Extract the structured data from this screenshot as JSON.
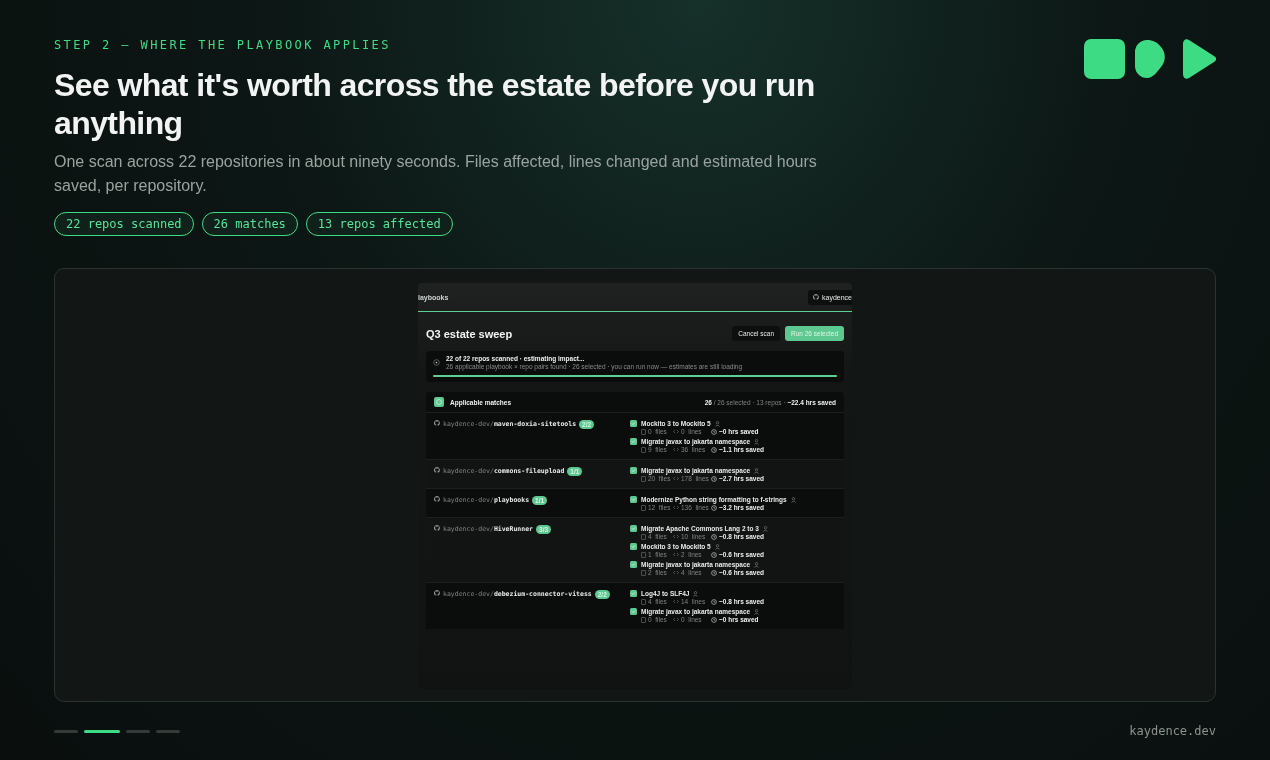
{
  "eyebrow": "STEP 2 — WHERE THE PLAYBOOK APPLIES",
  "title": "See what it's worth across the estate before you run anything",
  "subtitle": "One scan across 22 repositories in about ninety seconds. Files affected, lines changed and estimated hours saved, per repository.",
  "pills": [
    "22 repos scanned",
    "26 matches",
    "13 repos affected"
  ],
  "app": {
    "nav_label": "laybooks",
    "account_button": "kaydence",
    "heading": "Q3 estate sweep",
    "buttons": [
      {
        "label": "Cancel scan",
        "kind": "secondary"
      },
      {
        "label": "Run 26 selected",
        "kind": "primary"
      }
    ],
    "scan": {
      "title": "22 of 22 repos scanned · estimating impact...",
      "detail": "26 applicable playbook × repo pairs found · 26 selected · you can run now — estimates are still loading",
      "level": 1
    },
    "matches": {
      "title": "Applicable matches",
      "summary": "**26** / 26 selected · 13 repos · **~22.4 hrs saved**",
      "repos": [
        {
          "owner": "kaydence-dev/",
          "name": "maven-doxia-sitetools",
          "count": "2/2",
          "items": [
            {
              "title": "Mockito 3 to Mockito 5",
              "checked": true,
              "files": "0",
              "files_label": "files",
              "lines": "0",
              "lines_label": "lines",
              "saved": "~0 hrs saved"
            },
            {
              "title": "Migrate javax to jakarta namespace",
              "checked": true,
              "files": "9",
              "files_label": "files",
              "lines": "36",
              "lines_label": "lines",
              "saved": "~1.1 hrs saved"
            }
          ]
        },
        {
          "owner": "kaydence-dev/",
          "name": "commons-fileupload",
          "count": "1/1",
          "items": [
            {
              "title": "Migrate javax to jakarta namespace",
              "checked": true,
              "files": "20",
              "files_label": "files",
              "lines": "178",
              "lines_label": "lines",
              "saved": "~2.7 hrs saved"
            }
          ]
        },
        {
          "owner": "kaydence-dev/",
          "name": "playbooks",
          "count": "1/1",
          "items": [
            {
              "title": "Modernize Python string formatting to f-strings",
              "checked": true,
              "files": "12",
              "files_label": "files",
              "lines": "136",
              "lines_label": "lines",
              "saved": "~3.2 hrs saved"
            }
          ]
        },
        {
          "owner": "kaydence-dev/",
          "name": "HiveRunner",
          "count": "3/3",
          "items": [
            {
              "title": "Migrate Apache Commons Lang 2 to 3",
              "checked": true,
              "files": "4",
              "files_label": "files",
              "lines": "10",
              "lines_label": "lines",
              "saved": "~0.8 hrs saved"
            },
            {
              "title": "Mockito 3 to Mockito 5",
              "checked": true,
              "files": "1",
              "files_label": "files",
              "lines": "2",
              "lines_label": "lines",
              "saved": "~0.6 hrs saved"
            },
            {
              "title": "Migrate javax to jakarta namespace",
              "checked": true,
              "files": "2",
              "files_label": "files",
              "lines": "4",
              "lines_label": "lines",
              "saved": "~0.6 hrs saved"
            }
          ]
        },
        {
          "owner": "kaydence-dev/",
          "name": "debezium-connector-vitess",
          "count": "2/2",
          "items": [
            {
              "title": "Log4J to SLF4J",
              "checked": true,
              "files": "4",
              "files_label": "files",
              "lines": "14",
              "lines_label": "lines",
              "saved": "~0.8 hrs saved"
            },
            {
              "title": "Migrate javax to jakarta namespace",
              "checked": true,
              "files": "0",
              "files_label": "files",
              "lines": "0",
              "lines_label": "lines",
              "saved": "~0 hrs saved"
            }
          ]
        }
      ]
    }
  },
  "pagination": [
    {
      "selected": false
    },
    {
      "selected": true
    },
    {
      "selected": false
    },
    {
      "selected": false
    }
  ],
  "footer": "kaydence.dev"
}
